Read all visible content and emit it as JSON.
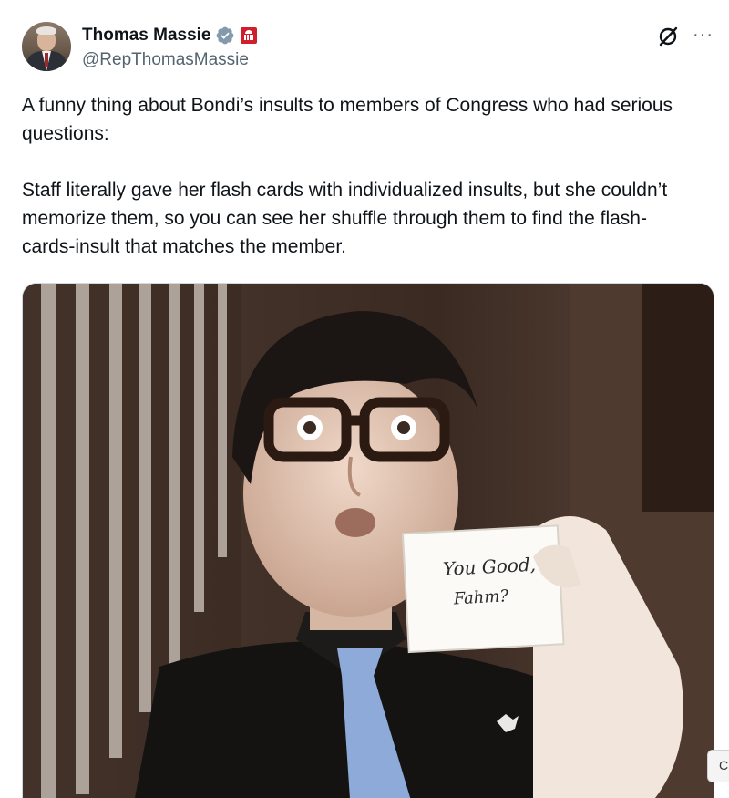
{
  "author": {
    "display_name": "Thomas Massie",
    "handle": "@RepThomasMassie",
    "verified_icon": "verified-badge-icon",
    "affiliation_icon": "us-capitol-flag-icon"
  },
  "actions": {
    "grok_icon": "grok-icon",
    "more_label": "···"
  },
  "tweet": {
    "text": "A funny thing about Bondi’s insults to members of Congress who had serious questions:\n\nStaff literally gave her flash cards with individualized insults, but she couldn’t memorize them, so you can see her shuffle through them to find the flash-cards-insult that matches the member."
  },
  "media": {
    "card_line1": "You Good,",
    "card_line2": "Fahm?"
  },
  "edge_tab": {
    "label": "C"
  },
  "colors": {
    "text": "#0f1419",
    "secondary": "#536471",
    "verified": "#829aab",
    "flag": "#d01f2b"
  }
}
